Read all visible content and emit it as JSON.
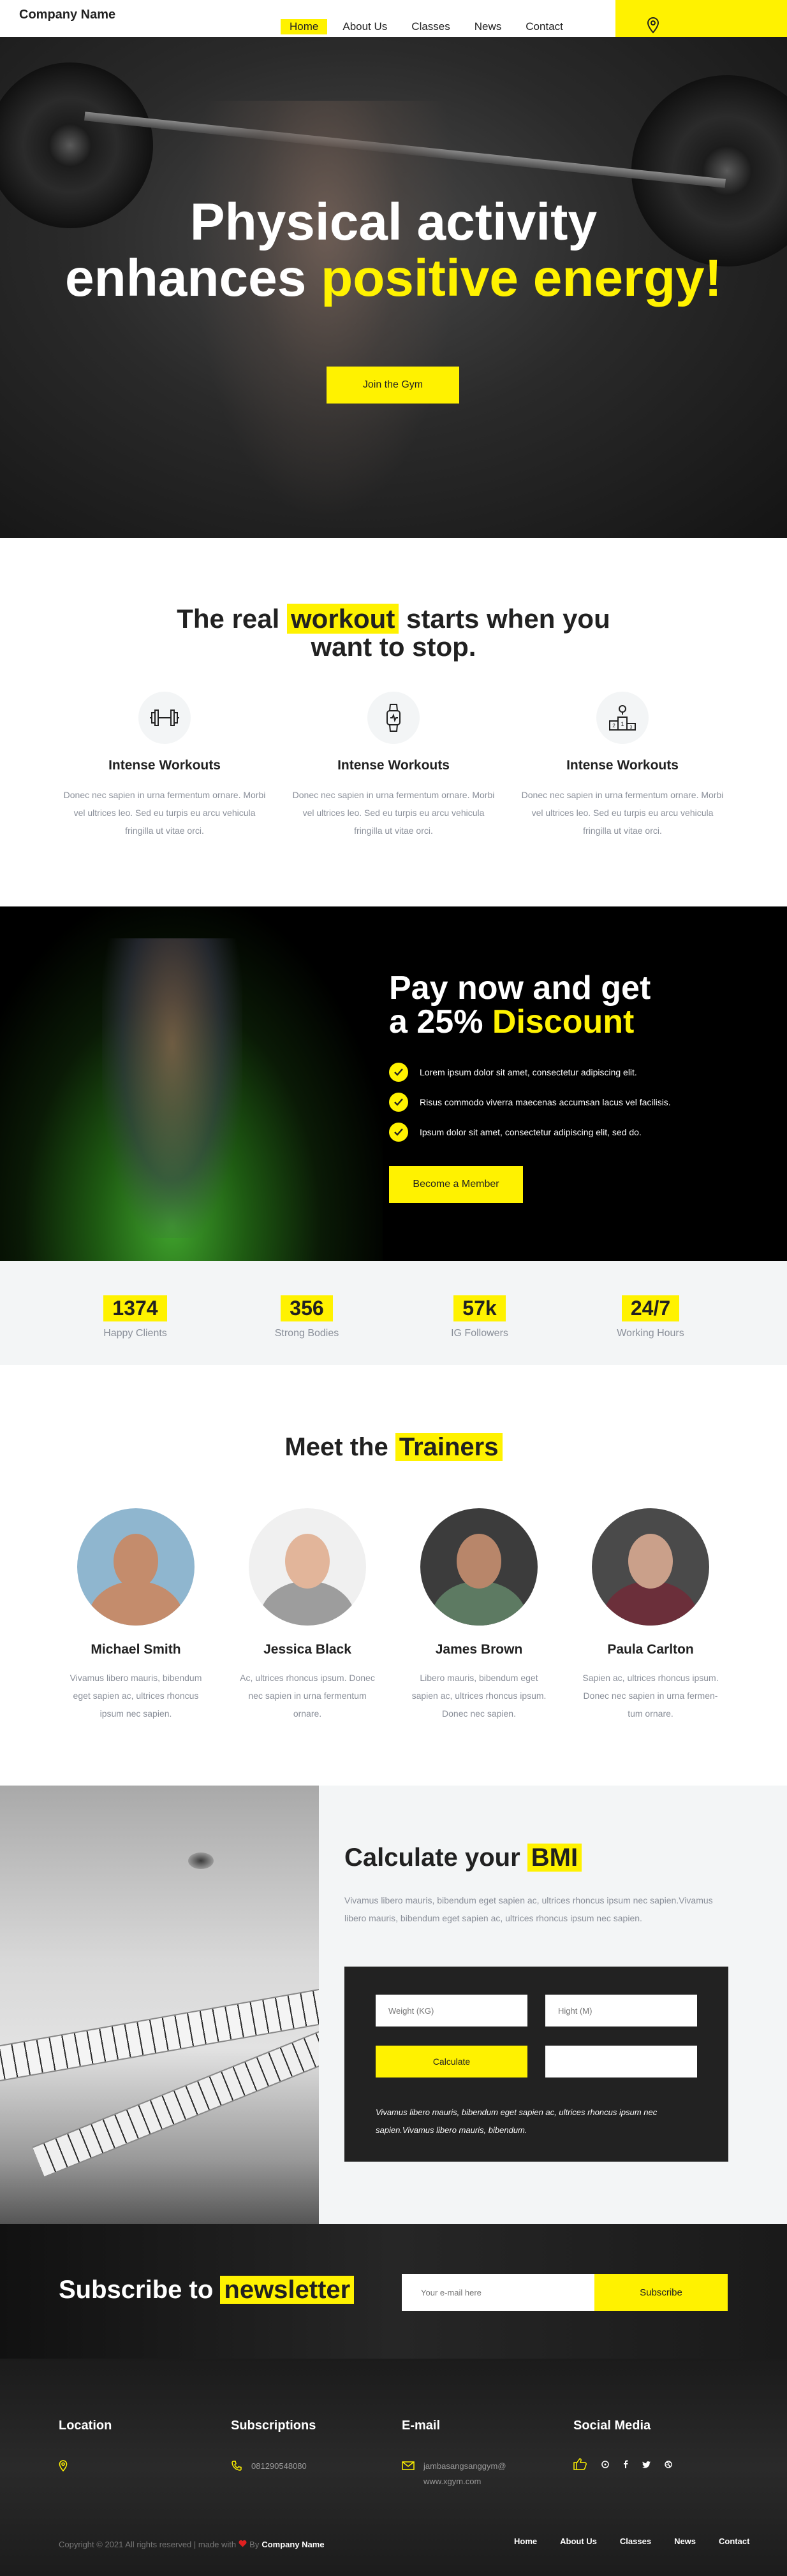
{
  "brand": "Company Name",
  "nav": {
    "items": [
      "Home",
      "About Us",
      "Classes",
      "News",
      "Contact"
    ]
  },
  "hero": {
    "title_line1": "Physical activity",
    "title_line2_a": "enhances ",
    "title_line2_b": "positive energy!",
    "button": "Join the Gym"
  },
  "features": {
    "title_a": "The real ",
    "title_hl": "workout",
    "title_b": " starts when you",
    "title_line2": "want to stop.",
    "items": [
      {
        "icon": "dumbbell-icon",
        "name": "Intense Workouts",
        "text": "Donec nec sapien in urna fermentum ornare. Morbi vel ultrices leo. Sed eu turpis eu arcu vehicula fringilla ut vitae orci."
      },
      {
        "icon": "smartwatch-icon",
        "name": "Intense Workouts",
        "text": "Donec nec sapien in urna fermentum ornare. Morbi vel ultrices leo. Sed eu turpis eu arcu vehicula fringilla ut vitae orci."
      },
      {
        "icon": "podium-icon",
        "name": "Intense Workouts",
        "text": "Donec nec sapien in urna fermentum ornare. Morbi vel ultrices leo. Sed eu turpis eu arcu vehicula fringilla ut vitae orci."
      }
    ]
  },
  "discount": {
    "title_line1": "Pay now and get",
    "title_line2_a": "a 25% ",
    "title_line2_b": "Discount",
    "points": [
      "Lorem ipsum dolor sit amet, consectetur adipiscing elit.",
      "Risus commodo viverra maecenas accumsan lacus vel facilisis.",
      "Ipsum dolor sit amet, consectetur adipiscing elit, sed do."
    ],
    "button": "Become a Member"
  },
  "stats": [
    {
      "value": "1374",
      "label": "Happy Clients"
    },
    {
      "value": "356",
      "label": "Strong Bodies"
    },
    {
      "value": "57k",
      "label": "IG Followers"
    },
    {
      "value": "24/7",
      "label": "Working Hours"
    }
  ],
  "trainers": {
    "title_a": "Meet the ",
    "title_hl": "Trainers",
    "items": [
      {
        "name": "Michael Smith",
        "text": "Vivamus libero mauris, bibendum eget sapien ac, ultrices rhoncus ipsum nec sapien.",
        "bg": "#8fb6cf",
        "skin": "#c48c6c",
        "shirt": "#c48c6c"
      },
      {
        "name": "Jessica Black",
        "text": "Ac, ultrices rhoncus ipsum. Donec nec sapien in urna fermentum ornare.",
        "bg": "#f0f0f0",
        "skin": "#e2b59a",
        "shirt": "#9d9d9d"
      },
      {
        "name": "James Brown",
        "text": "Libero mauris, bibendum eget sapien ac, ultrices rhoncus ipsum. Donec nec sapien.",
        "bg": "#3c3c3c",
        "skin": "#b8866a",
        "shirt": "#5d7a62"
      },
      {
        "name": "Paula Carlton",
        "text": "Sapien ac, ultrices rhoncus ipsum. Donec nec sapien in urna fermen-tum ornare.",
        "bg": "#4a4a4a",
        "skin": "#caa08a",
        "shirt": "#6b2f3a"
      }
    ]
  },
  "bmi": {
    "title_a": "Calculate your ",
    "title_hl": "BMI",
    "intro": "Vivamus libero mauris, bibendum eget sapien ac, ultrices rhoncus ipsum nec sapien.Vivamus libero mauris, bibendum eget sapien ac, ultrices rhoncus ipsum nec sapien.",
    "weight_placeholder": "Weight (KG)",
    "height_placeholder": "Hight (M)",
    "calc_button": "Calculate",
    "result_placeholder": "",
    "note": "Vivamus libero mauris, bibendum eget sapien ac, ultrices rhoncus ipsum nec sapien.Vivamus libero mauris, bibendum."
  },
  "newsletter": {
    "title_a": "Subscribe to ",
    "title_hl": "newsletter",
    "placeholder": "Your e-mail here",
    "button": "Subscribe"
  },
  "footer": {
    "location_head": "Location",
    "subs_head": "Subscriptions",
    "phone": "081290548080",
    "email_head": "E-mail",
    "email": "jambasangsanggym@",
    "website": "www.xgym.com",
    "social_head": "Social Media",
    "social_icons": [
      "thumbs-up-icon",
      "pinterest-icon",
      "facebook-icon",
      "twitter-icon",
      "dribbble-icon"
    ],
    "copyright": "Copyright © 2021 All rights reserved | made with",
    "by": "By",
    "company": "Company Name",
    "links": [
      "Home",
      "About Us",
      "Classes",
      "News",
      "Contact"
    ]
  },
  "colors": {
    "accent": "#fff200",
    "dark": "#212121",
    "muted": "#8a8f99",
    "light_bg": "#f3f5f6",
    "heart": "#e02020"
  }
}
